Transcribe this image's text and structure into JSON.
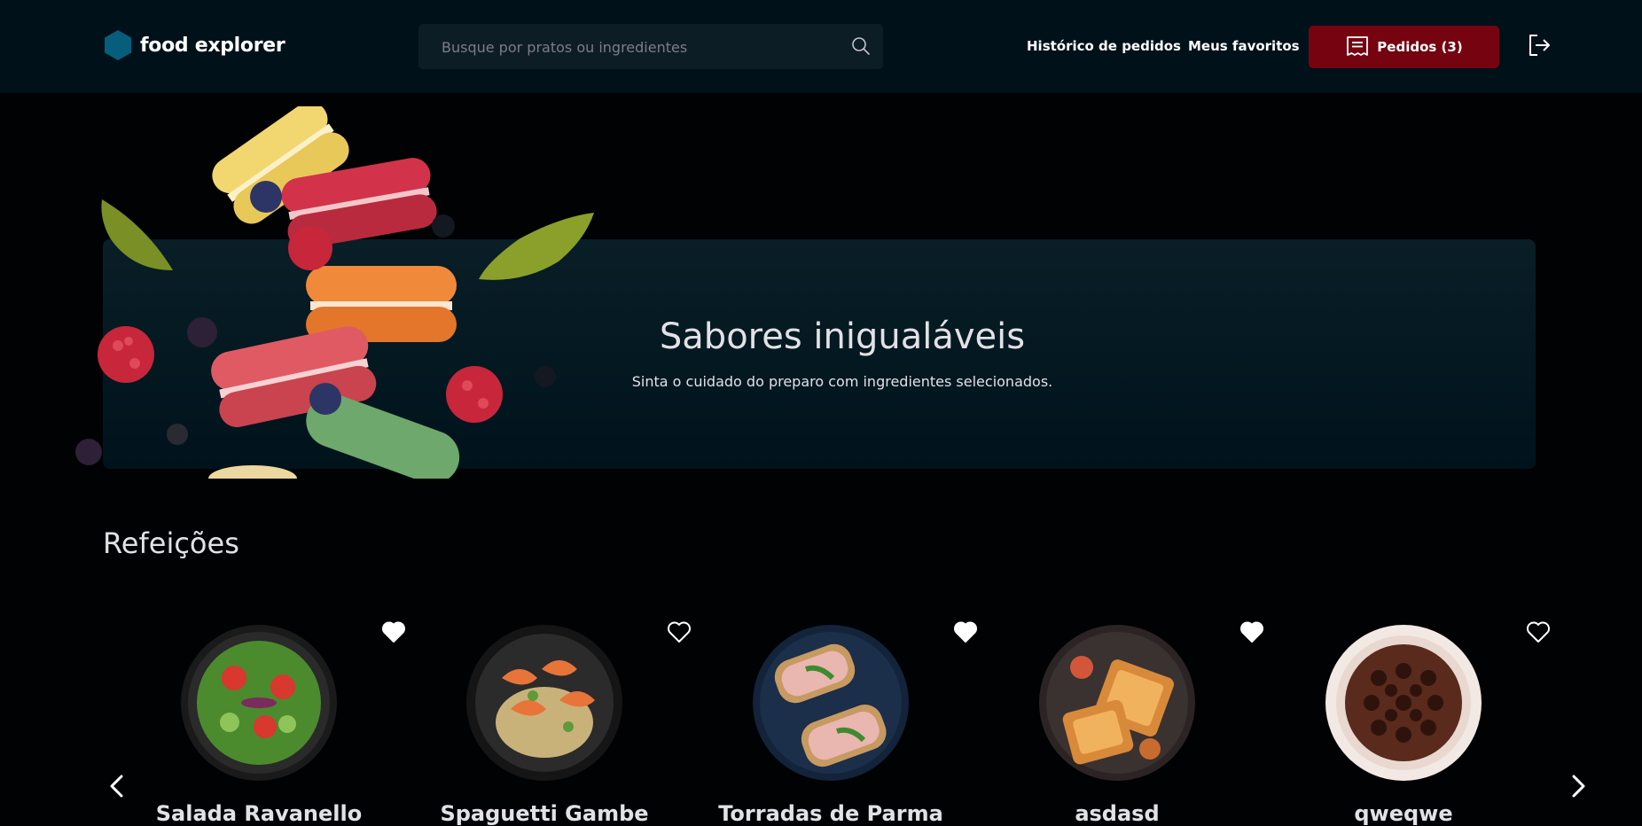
{
  "header": {
    "brand": "food explorer",
    "search_placeholder": "Busque por pratos ou ingredientes",
    "nav": {
      "order_history": "Histórico de pedidos",
      "favorites": "Meus favoritos"
    },
    "orders_button": "Pedidos (3)"
  },
  "banner": {
    "title": "Sabores inigualáveis",
    "subtitle": "Sinta o cuidado do preparo com ingredientes selecionados."
  },
  "section": {
    "title": "Refeições",
    "dishes": [
      {
        "name": "Salada Ravanello",
        "favorited": true
      },
      {
        "name": "Spaguetti Gambe",
        "favorited": false
      },
      {
        "name": "Torradas de Parma",
        "favorited": true
      },
      {
        "name": "asdasd",
        "favorited": true
      },
      {
        "name": "qweqwe",
        "favorited": false
      }
    ]
  },
  "colors": {
    "header_bg": "#00111A",
    "page_bg": "#000204",
    "accent": "#750310",
    "logo": "#065E7C"
  },
  "icons": [
    "search-icon",
    "receipt-icon",
    "logout-icon",
    "heart-icon",
    "chevron-left-icon",
    "chevron-right-icon"
  ]
}
